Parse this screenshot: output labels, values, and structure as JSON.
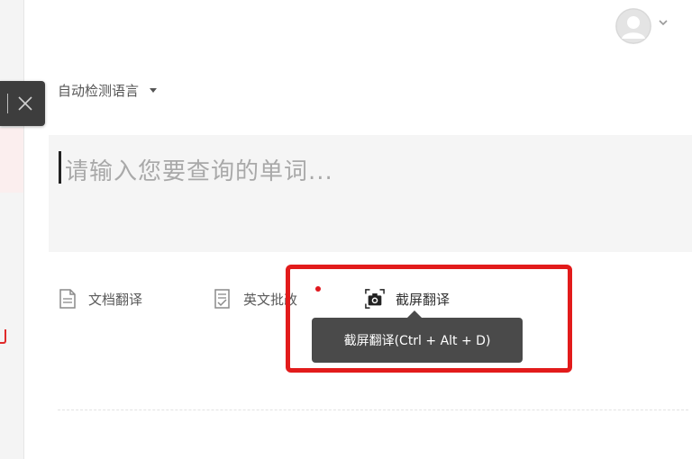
{
  "language": {
    "selected": "自动检测语言"
  },
  "input": {
    "placeholder": "请输入您要查询的单词..."
  },
  "tools": [
    {
      "label": "文档翻译",
      "icon": "document-icon"
    },
    {
      "label": "英文批改",
      "icon": "essay-correction-icon"
    },
    {
      "label": "截屏翻译",
      "icon": "screenshot-camera-icon"
    }
  ],
  "tooltip": {
    "text": "截屏翻译(Ctrl + Alt + D)"
  },
  "colors": {
    "highlight": "#e21b1b",
    "tooltip_bg": "#4a4a4a",
    "new_dot": "#e0181e",
    "input_bg": "#f5f5f5"
  }
}
